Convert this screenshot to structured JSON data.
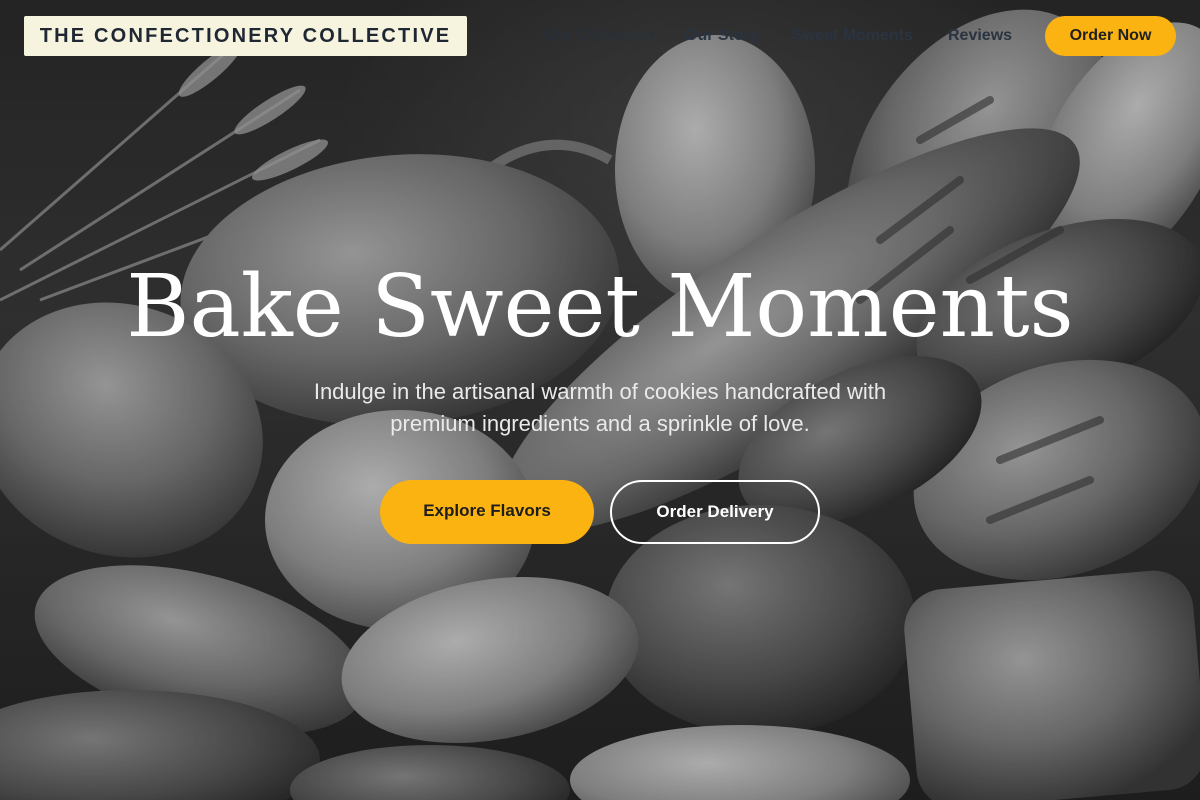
{
  "header": {
    "logo_text": "THE CONFECTIONERY COLLECTIVE",
    "nav": [
      {
        "label": "Our Collection"
      },
      {
        "label": "Our Story"
      },
      {
        "label": "Sweet Moments"
      },
      {
        "label": "Reviews"
      }
    ],
    "cta_label": "Order Now"
  },
  "hero": {
    "headline": "Bake Sweet Moments",
    "subtext_line1": "Indulge in the artisanal warmth of cookies handcrafted with",
    "subtext_line2": "premium ingredients and a sprinkle of love.",
    "primary_button": "Explore Flavors",
    "secondary_button": "Order Delivery"
  },
  "colors": {
    "accent": "#fbb312",
    "logo_bg": "#f6f3df",
    "nav_text": "#2a3340",
    "headline": "#ffffff"
  }
}
